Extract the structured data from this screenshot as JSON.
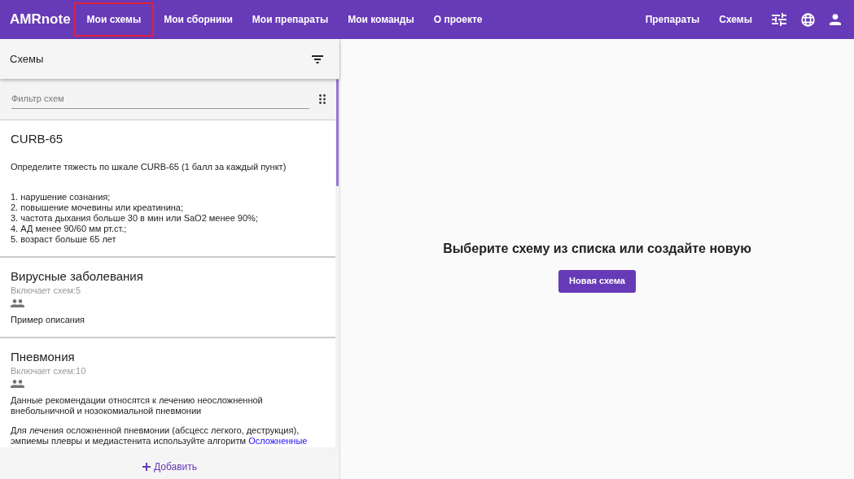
{
  "app": {
    "logo": "AMRnote"
  },
  "nav": [
    {
      "label": "Мои схемы",
      "selected": true
    },
    {
      "label": "Мои сборники",
      "selected": false
    },
    {
      "label": "Мои препараты",
      "selected": false
    },
    {
      "label": "Мои команды",
      "selected": false
    },
    {
      "label": "О проекте",
      "selected": false
    }
  ],
  "nav_right": [
    "Препараты",
    "Схемы"
  ],
  "sidebar": {
    "title": "Схемы",
    "filter_placeholder": "Фильтр схем",
    "add_label": "Добавить",
    "items": [
      {
        "kind": "scheme",
        "title": "CURB-65",
        "paragraphs": [
          "Определите тяжесть по шкале CURB-65 (1 балл за каждый пункт)",
          "1. нарушение сознания;\n2. повышение мочевины или креатинина;\n3. частота дыхания больше 30 в мин или SaO2 менее 90%;\n4. АД менее 90/60 мм рт.ст.;\n5. возраст больше 65 лет"
        ]
      },
      {
        "kind": "collection",
        "title": "Вирусные заболевания",
        "count": "Включает схем:5",
        "paragraphs": [
          "Пример описания"
        ]
      },
      {
        "kind": "collection",
        "title": "Пневмония",
        "count": "Включает схем:10",
        "paragraphs": [
          "Данные рекомендации относятся к лечению неосложненной внебольничной и нозокомиальной пневмонии",
          "Для лечения осложненной пневмонии (абсцесс легкого, деструкция), эмпиемы плевры и медиастенита используйте алгоритм "
        ],
        "link": "Осложненные"
      }
    ]
  },
  "main": {
    "message": "Выберите схему из списка или создайте новую",
    "button": "Новая схема"
  }
}
